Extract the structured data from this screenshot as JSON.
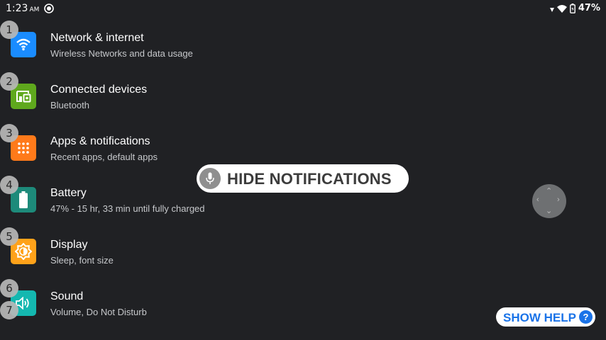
{
  "status_bar": {
    "time": "1:23",
    "ampm": "AM",
    "battery_percent": "47%",
    "icons": [
      "app-notification-icon",
      "signal-icon",
      "wifi-icon",
      "battery-charging-icon"
    ]
  },
  "settings": {
    "items": [
      {
        "badge": "1",
        "title": "Network & internet",
        "subtitle": "Wireless Networks and data usage",
        "icon": "wifi-icon",
        "color": "#1a8cff"
      },
      {
        "badge": "2",
        "title": "Connected devices",
        "subtitle": "Bluetooth",
        "icon": "devices-icon",
        "color": "#5fa81d"
      },
      {
        "badge": "3",
        "title": "Apps & notifications",
        "subtitle": "Recent apps, default apps",
        "icon": "apps-grid-icon",
        "color": "#ff7a1a"
      },
      {
        "badge": "4",
        "title": "Battery",
        "subtitle": "47% - 15 hr, 33 min until fully charged",
        "icon": "battery-icon",
        "color": "#1d8a7a"
      },
      {
        "badge": "5",
        "title": "Display",
        "subtitle": "Sleep, font size",
        "icon": "brightness-icon",
        "color": "#ffa21a"
      },
      {
        "badge": "6",
        "title": "Sound",
        "subtitle": "Volume, Do Not Disturb",
        "icon": "volume-icon",
        "color": "#14b8b0"
      }
    ],
    "extra_badge": "7"
  },
  "overlay": {
    "hide_notifications_label": "HIDE NOTIFICATIONS",
    "show_help_label": "SHOW HELP",
    "help_glyph": "?"
  }
}
